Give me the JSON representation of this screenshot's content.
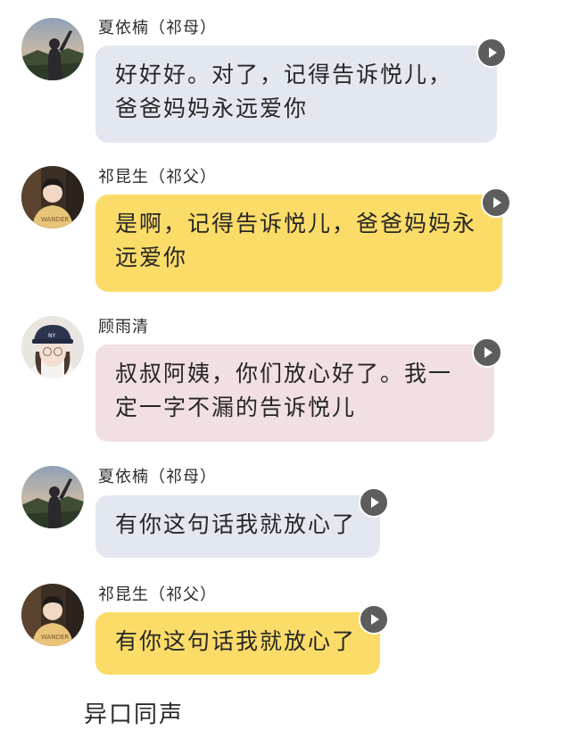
{
  "messages": [
    {
      "sender": "夏依楠（祁母）",
      "avatar_icon": "avatar-woman-mountain-sunset",
      "bubble_color": "#e3e8f0",
      "text": "好好好。对了，记得告诉悦儿，爸爸妈妈永远爱你"
    },
    {
      "sender": "祁昆生（祁父）",
      "avatar_icon": "avatar-person-yellow-sweater",
      "bubble_color": "#fcdc68",
      "text": "是啊，记得告诉悦儿，爸爸妈妈永远爱你"
    },
    {
      "sender": "顾雨清",
      "avatar_icon": "avatar-girl-navy-cap",
      "bubble_color": "#f1dfe1",
      "text": "叔叔阿姨，你们放心好了。我一定一字不漏的告诉悦儿"
    },
    {
      "sender": "夏依楠（祁母）",
      "avatar_icon": "avatar-woman-mountain-sunset",
      "bubble_color": "#e3e8f0",
      "text": "有你这句话我就放心了"
    },
    {
      "sender": "祁昆生（祁父）",
      "avatar_icon": "avatar-person-yellow-sweater",
      "bubble_color": "#fcdc68",
      "text": "有你这句话我就放心了"
    }
  ],
  "caption": "异口同声"
}
